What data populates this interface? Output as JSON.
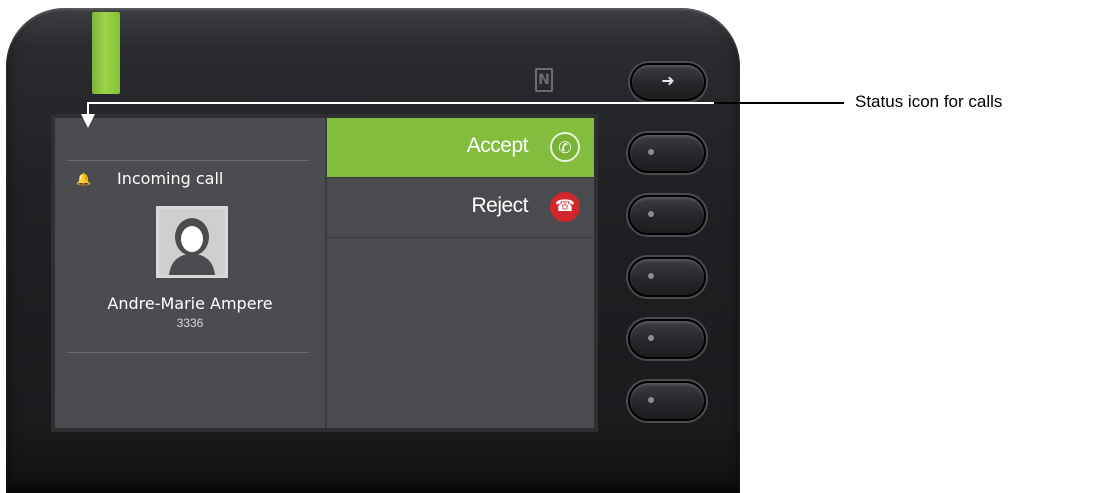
{
  "annotation": {
    "label": "Status icon for calls"
  },
  "call_screen": {
    "status_icon": "bell-icon",
    "status_text": "Incoming call",
    "caller": {
      "name": "Andre-Marie Ampere",
      "number": "3336",
      "avatar_icon": "person-avatar"
    }
  },
  "menu": {
    "items": [
      {
        "label": "Accept",
        "icon": "phone-accept-icon",
        "color": "#82bd3e",
        "selected": true
      },
      {
        "label": "Reject",
        "icon": "phone-reject-icon",
        "color": "#d0262c",
        "selected": false
      }
    ]
  },
  "device": {
    "led_color": "#9ed449",
    "nfc_icon": "nfc-icon",
    "leave_icon": "leave-arrow-icon"
  }
}
